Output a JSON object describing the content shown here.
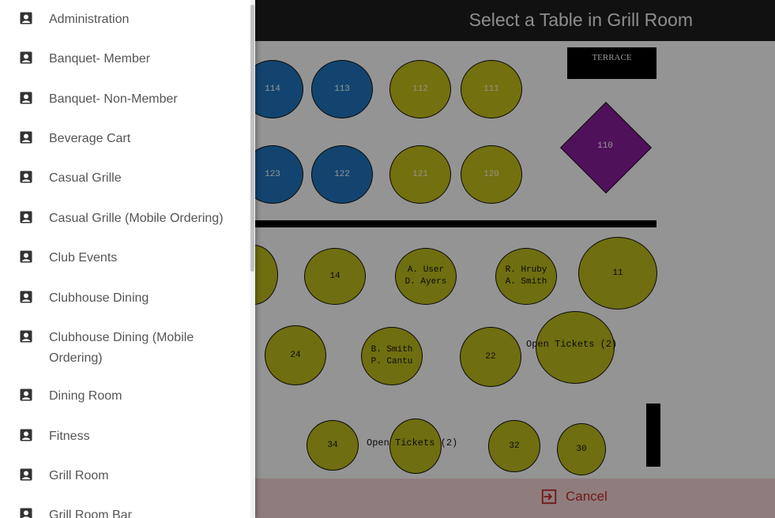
{
  "header": {
    "title": "Select a Table in Grill Room"
  },
  "floor": {
    "terrace_label": "TERRACE",
    "diamond_table": "110",
    "blue_tables": [
      "114",
      "113",
      "123",
      "122"
    ],
    "yellow_tables": [
      "112",
      "111",
      "121",
      "120"
    ],
    "olive_tables": {
      "t14": "14",
      "t11": "11",
      "t24": "24",
      "t22": "22",
      "t34": "34",
      "t32": "32",
      "t30": "30"
    },
    "guest_tables": {
      "a_line1": "A. User",
      "a_line2": "D. Ayers",
      "b_line1": "R. Hruby",
      "b_line2": "A. Smith",
      "c_line1": "B. Smith",
      "c_line2": "P. Cantu"
    },
    "open_tickets_1": "Open Tickets (2)",
    "open_tickets_2": "Open Tickets (2)"
  },
  "bottom_bar": {
    "cancel_label": "Cancel"
  },
  "drawer": {
    "items": [
      {
        "label": "Administration"
      },
      {
        "label": "Banquet- Member"
      },
      {
        "label": "Banquet- Non-Member"
      },
      {
        "label": "Beverage Cart"
      },
      {
        "label": "Casual Grille"
      },
      {
        "label": "Casual Grille (Mobile Ordering)"
      },
      {
        "label": "Club Events"
      },
      {
        "label": "Clubhouse Dining"
      },
      {
        "label": "Clubhouse Dining (Mobile Ordering)"
      },
      {
        "label": "Dining Room"
      },
      {
        "label": "Fitness"
      },
      {
        "label": "Grill Room"
      },
      {
        "label": "Grill Room Bar"
      }
    ]
  },
  "colors": {
    "header_bg": "#1e1e1e",
    "blue_table": "#1f76c0",
    "yellow_table": "#c7c21a",
    "diamond": "#8a1e9e",
    "cancel": "#c62828"
  }
}
